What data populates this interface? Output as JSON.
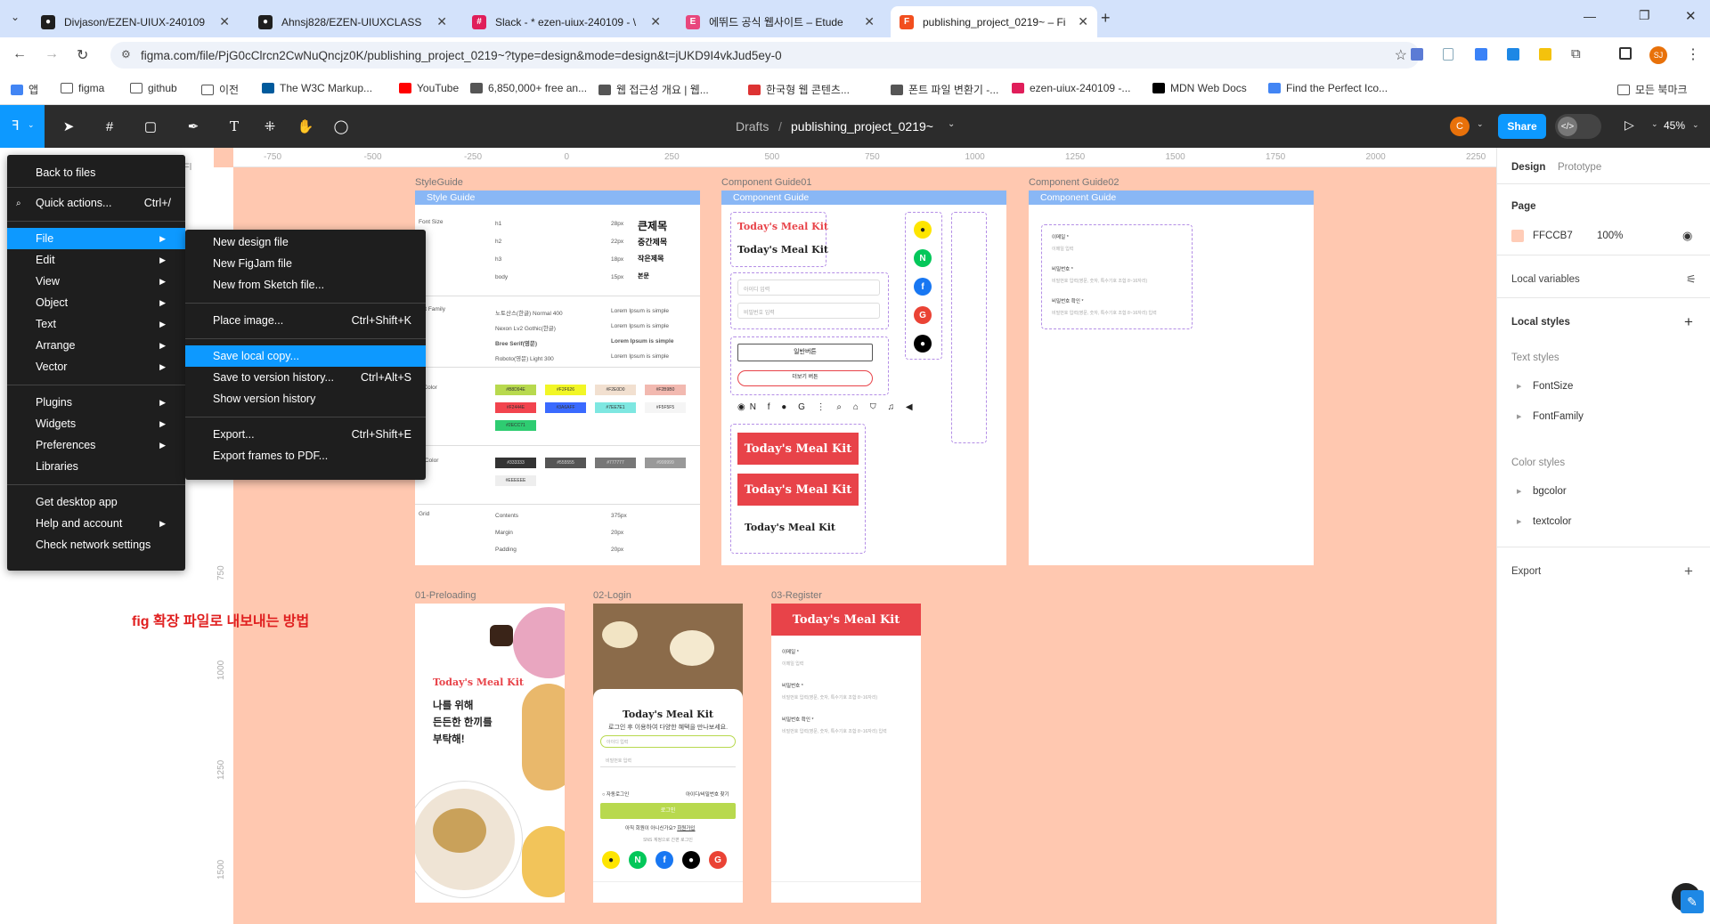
{
  "browser": {
    "tabs": [
      {
        "title": "Divjason/EZEN-UIUX-240109",
        "icon": "github-icon",
        "color": "#1f1f1f"
      },
      {
        "title": "Ahnsj828/EZEN-UIUXCLASS",
        "icon": "github-icon",
        "color": "#1f1f1f"
      },
      {
        "title": "Slack - * ezen-uiux-240109 - \\",
        "icon": "slack-icon",
        "color": "#e01e5a"
      },
      {
        "title": "에뛰드 공식 웹사이트 – Etude",
        "icon": "etude-icon",
        "color": "#e8477d"
      },
      {
        "title": "publishing_project_0219~ – Fi",
        "icon": "figma-icon",
        "color": "#f24e1e"
      }
    ],
    "url": "figma.com/file/PjG0cClrcn2CwNuQncjz0K/publishing_project_0219~?type=design&mode=design&t=jUKD9I4vkJud5ey-0",
    "profile_initials": "SJ",
    "bookmarks": [
      {
        "label": "앱",
        "icon": "apps-icon"
      },
      {
        "label": "figma",
        "icon": "folder-icon"
      },
      {
        "label": "github",
        "icon": "folder-icon"
      },
      {
        "label": "이전",
        "icon": "folder-icon"
      },
      {
        "label": "The W3C Markup...",
        "icon": "w3c-icon"
      },
      {
        "label": "YouTube",
        "icon": "youtube-icon"
      },
      {
        "label": "6,850,000+ free an...",
        "icon": "site-icon"
      },
      {
        "label": "웹 접근성 개요 | 웹...",
        "icon": "site-icon"
      },
      {
        "label": "한국형 웹 콘텐츠...",
        "icon": "pdf-icon"
      },
      {
        "label": "폰트 파일 변환기 -...",
        "icon": "site-icon"
      },
      {
        "label": "ezen-uiux-240109 -...",
        "icon": "slack-icon"
      },
      {
        "label": "MDN Web Docs",
        "icon": "mdn-icon"
      },
      {
        "label": "Find the Perfect Ico...",
        "icon": "flag-icon"
      }
    ],
    "bookmarks_all": "모든 북마크"
  },
  "figma": {
    "breadcrumb_drafts": "Drafts",
    "breadcrumb_sep": "/",
    "file_name": "publishing_project_0219~",
    "share_label": "Share",
    "zoom": "45%",
    "avatar_initial": "C",
    "ruler_x": [
      "-750",
      "-500",
      "-250",
      "0",
      "250",
      "500",
      "750",
      "1000",
      "1250",
      "1500",
      "1750",
      "2000",
      "2250"
    ],
    "ruler_y": [
      "750",
      "1000",
      "1250",
      "1500"
    ],
    "layer_tab_hint": "Fl"
  },
  "main_menu": {
    "items": [
      {
        "label": "Back to files",
        "shortcut": "",
        "arrow": false
      },
      {
        "label": "Quick actions...",
        "shortcut": "Ctrl+/",
        "arrow": false
      },
      {
        "label": "File",
        "shortcut": "",
        "arrow": true,
        "selected": true
      },
      {
        "label": "Edit",
        "shortcut": "",
        "arrow": true
      },
      {
        "label": "View",
        "shortcut": "",
        "arrow": true
      },
      {
        "label": "Object",
        "shortcut": "",
        "arrow": true
      },
      {
        "label": "Text",
        "shortcut": "",
        "arrow": true
      },
      {
        "label": "Arrange",
        "shortcut": "",
        "arrow": true
      },
      {
        "label": "Vector",
        "shortcut": "",
        "arrow": true
      },
      {
        "label": "Plugins",
        "shortcut": "",
        "arrow": true
      },
      {
        "label": "Widgets",
        "shortcut": "",
        "arrow": true
      },
      {
        "label": "Preferences",
        "shortcut": "",
        "arrow": true
      },
      {
        "label": "Libraries",
        "shortcut": "",
        "arrow": false
      },
      {
        "label": "Get desktop app",
        "shortcut": "",
        "arrow": false
      },
      {
        "label": "Help and account",
        "shortcut": "",
        "arrow": true
      },
      {
        "label": "Check network settings",
        "shortcut": "",
        "arrow": false
      }
    ]
  },
  "file_submenu": {
    "items": [
      {
        "label": "New design file",
        "shortcut": ""
      },
      {
        "label": "New FigJam file",
        "shortcut": ""
      },
      {
        "label": "New from Sketch file...",
        "shortcut": ""
      },
      {
        "label": "Place image...",
        "shortcut": "Ctrl+Shift+K"
      },
      {
        "label": "Save local copy...",
        "shortcut": "",
        "selected": true
      },
      {
        "label": "Save to version history...",
        "shortcut": "Ctrl+Alt+S"
      },
      {
        "label": "Show version history",
        "shortcut": ""
      },
      {
        "label": "Export...",
        "shortcut": "Ctrl+Shift+E"
      },
      {
        "label": "Export frames to PDF...",
        "shortcut": ""
      }
    ]
  },
  "canvas": {
    "annotation": "fig 확장 파일로 내보내는 방법",
    "frame_labels": {
      "styleguide": "StyleGuide",
      "component01": "Component Guide01",
      "component02": "Component Guide02",
      "preloading": "01-Preloading",
      "login": "02-Login",
      "register": "03-Register"
    },
    "frame_headers": {
      "styleguide": "Style Guide",
      "component01": "Component Guide",
      "component02": "Component Guide"
    },
    "styleguide": {
      "font_size_label": "Font Size",
      "font_sizes": [
        {
          "tag": "h1",
          "px": "28px",
          "sample": "큰제목"
        },
        {
          "tag": "h2",
          "px": "22px",
          "sample": "중간제목"
        },
        {
          "tag": "h3",
          "px": "18px",
          "sample": "작은제목"
        },
        {
          "tag": "body",
          "px": "15px",
          "sample": "본문"
        }
      ],
      "font_family_label": "ont Family",
      "font_families": [
        {
          "name": "노토산스(한글) Normal 400",
          "sample": "Lorem Ipsum is simple"
        },
        {
          "name": "Nexon Lv2 Gothic(한글)",
          "sample": "Lorem Ipsum is simple"
        },
        {
          "name": "Bree Serif(영문)",
          "sample": "Lorem Ipsum is simple"
        },
        {
          "name": "Roboto(영문) Light 300",
          "sample": "Lorem Ipsum is simple"
        }
      ],
      "bg_color_label": "g Color",
      "bg_colors": [
        "#B8D94E",
        "#F2F626",
        "#F2E0D0",
        "#F2B9B0",
        "#F2444E",
        "#3A6AFF",
        "#7EE7E1",
        "#F5F5F5",
        "#2ECC71"
      ],
      "text_color_label": "xt Color",
      "text_colors": [
        "#333333",
        "#555555",
        "#777777",
        "#999999",
        "#EEEEEE"
      ],
      "grid_label": "Grid",
      "grid": [
        {
          "name": "Contents",
          "value": "375px"
        },
        {
          "name": "Margin",
          "value": "20px"
        },
        {
          "name": "Padding",
          "value": "20px"
        }
      ]
    },
    "component": {
      "brand": "Today's Meal Kit",
      "input_id": "아이디 입력",
      "input_pw": "비밀번호 입력",
      "btn_primary": "일반버튼",
      "btn_more": "더보기 버튼"
    },
    "component02": {
      "email": "이메일 *",
      "email_ph": "이메일 입력",
      "pw": "비밀번호 *",
      "pw_ph": "비밀번호 입력(영문, 숫자, 특수기호 조합 8~16자리)",
      "pw2": "비밀번호 확인 *",
      "pw2_ph": "비밀번호 입력(영문, 숫자, 특수기호 조합 8~16자리) 입력"
    },
    "preloading": {
      "brand": "Today's Meal Kit",
      "line1": "나를 위해",
      "line2": "든든한 한끼를",
      "line3": "부탁해!"
    },
    "login": {
      "brand": "Today's Meal Kit",
      "subtitle": "로그인 후 이용하여 다양한 혜택을 만나보세요.",
      "id_ph": "아이디 입력",
      "pw_ph": "비밀번호 입력",
      "auto": "자동로그인",
      "find": "아이디/비밀번호 찾기",
      "btn": "로그인",
      "join_q": "아직 회원이 아니신가요?",
      "join": "회원가입",
      "sns": "SNS 계정으로 간편 로그인"
    },
    "register": {
      "brand": "Today's Meal Kit",
      "email": "이메일 *",
      "email_ph": "이메일 입력",
      "pw": "비밀번호 *",
      "pw_ph": "비밀번호 입력(영문, 숫자, 특수기호 조합 8~16자리)",
      "pw2": "비밀번호 확인 *",
      "pw2_ph": "비밀번호 입력(영문, 숫자, 특수기호 조합 8~16자리) 입력"
    }
  },
  "right_panel": {
    "tab_design": "Design",
    "tab_prototype": "Prototype",
    "page_title": "Page",
    "page_color": "FFCCB7",
    "page_opacity": "100%",
    "local_variables": "Local variables",
    "local_styles": "Local styles",
    "text_styles": "Text styles",
    "text_style_items": [
      "FontSize",
      "FontFamily"
    ],
    "color_styles": "Color styles",
    "color_style_items": [
      "bgcolor",
      "textcolor"
    ],
    "export": "Export"
  },
  "colors": {
    "canvas_bg": "#ffc8b0",
    "accent": "#0d99ff",
    "brand_red": "#e84349",
    "menu_bg": "#1e1e1e"
  }
}
